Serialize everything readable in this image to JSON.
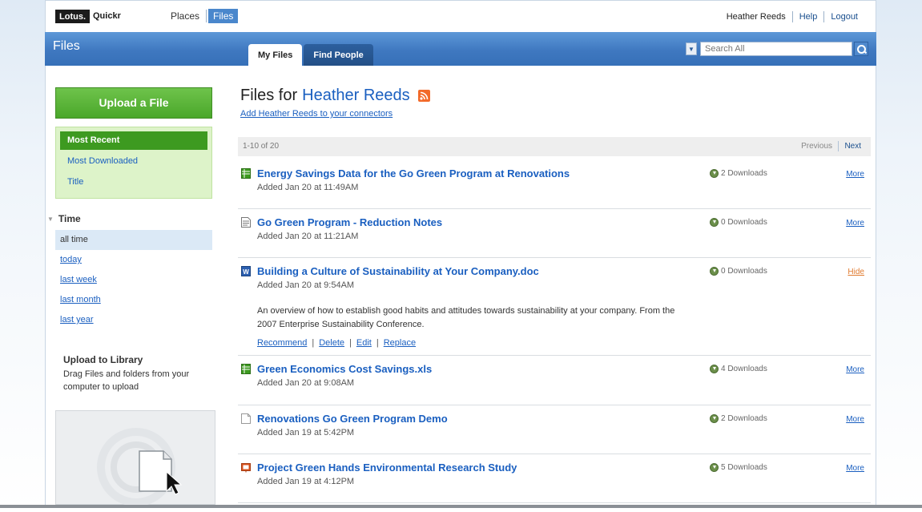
{
  "app": {
    "logo_lotus": "Lotus.",
    "logo_quickr": "Quickr",
    "nav": [
      {
        "label": "Places",
        "active": false
      },
      {
        "label": "Files",
        "active": true
      }
    ],
    "user_links": [
      "Heather Reeds",
      "Help",
      "Logout"
    ]
  },
  "header": {
    "title": "Files",
    "tabs": [
      {
        "label": "My Files",
        "active": true
      },
      {
        "label": "Find People",
        "active": false
      }
    ],
    "search": {
      "placeholder": "Search All"
    }
  },
  "sidebar": {
    "upload_label": "Upload a File",
    "sort_items": [
      {
        "label": "Most Recent",
        "active": true
      },
      {
        "label": "Most Downloaded",
        "active": false
      },
      {
        "label": "Title",
        "active": false
      }
    ],
    "time_heading": "Time",
    "time_items": [
      {
        "label": "all time",
        "active": true
      },
      {
        "label": "today",
        "active": false
      },
      {
        "label": "last week",
        "active": false
      },
      {
        "label": "last month",
        "active": false
      },
      {
        "label": "last year",
        "active": false
      }
    ],
    "upload_library_title": "Upload to Library",
    "upload_library_desc": "Drag Files and folders from your computer to upload"
  },
  "content": {
    "title_prefix": "Files for",
    "title_name": "Heather Reeds",
    "connector_link": "Add Heather Reeds to your connectors",
    "pager": {
      "count": "1-10 of 20",
      "previous": "Previous",
      "next": "Next"
    },
    "files": [
      {
        "title": "Energy Savings Data for the Go Green Program at Renovations",
        "added": "Added Jan 20 at 11:49AM",
        "downloads": "2 Downloads",
        "action": "More",
        "icon": "spreadsheet-icon",
        "icon_color": "#3d9a20"
      },
      {
        "title": "Go Green Program - Reduction Notes",
        "added": "Added Jan 20 at 11:21AM",
        "downloads": "0 Downloads",
        "action": "More",
        "icon": "notes-icon",
        "icon_color": "#777777"
      },
      {
        "title": "Building a Culture of Sustainability at Your Company.doc",
        "added": "Added Jan 20 at 9:54AM",
        "downloads": "0 Downloads",
        "action": "Hide",
        "icon": "word-doc-icon",
        "icon_color": "#2b5fb0",
        "description": "An overview of how to establish good habits and attitudes towards sustainability at your company. From the 2007 Enterprise Sustainability Conference.",
        "links": [
          "Recommend",
          "Delete",
          "Edit",
          "Replace"
        ]
      },
      {
        "title": "Green Economics Cost Savings.xls",
        "added": "Added Jan 20 at 9:08AM",
        "downloads": "4 Downloads",
        "action": "More",
        "icon": "spreadsheet-icon",
        "icon_color": "#3d9a20"
      },
      {
        "title": "Renovations Go Green Program Demo",
        "added": "Added Jan 19 at 5:42PM",
        "downloads": "2 Downloads",
        "action": "More",
        "icon": "blank-file-icon",
        "icon_color": "#999999"
      },
      {
        "title": "Project Green Hands Environmental Research Study",
        "added": "Added Jan 19 at 4:12PM",
        "downloads": "5 Downloads",
        "action": "More",
        "icon": "presentation-icon",
        "icon_color": "#d9531e"
      }
    ]
  }
}
